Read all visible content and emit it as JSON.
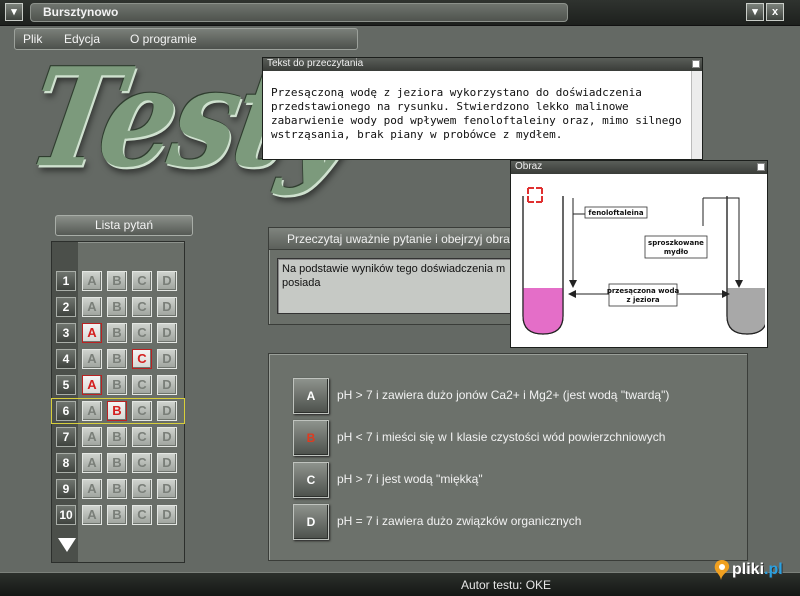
{
  "window": {
    "title": "Bursztynowo",
    "min_btn": "▾",
    "close_btn": "x",
    "menu_btn": "▾"
  },
  "menu": [
    "Plik",
    "Edycja",
    "O programie"
  ],
  "logo_text": "Testy",
  "question_list": {
    "header": "Lista pytań",
    "rows": [
      {
        "n": "1",
        "selected": ""
      },
      {
        "n": "2",
        "selected": ""
      },
      {
        "n": "3",
        "selected": "A"
      },
      {
        "n": "4",
        "selected": "C"
      },
      {
        "n": "5",
        "selected": "A"
      },
      {
        "n": "6",
        "selected": "B"
      },
      {
        "n": "7",
        "selected": ""
      },
      {
        "n": "8",
        "selected": ""
      },
      {
        "n": "9",
        "selected": ""
      },
      {
        "n": "10",
        "selected": ""
      }
    ],
    "options": [
      "A",
      "B",
      "C",
      "D"
    ],
    "current_row": "6"
  },
  "reading": {
    "title": "Tekst do przeczytania",
    "lines": [
      "Przesączoną wodę z jeziora wykorzystano do doświadczenia",
      "przedstawionego na rysunku. Stwierdzono lekko malinowe",
      "zabarwienie wody pod wpływem fenoloftaleiny oraz, mimo silnego",
      "wstrząsania, brak piany w probówce z mydłem."
    ]
  },
  "question": {
    "title": "Przeczytaj uważnie pytanie i obejrzyj obraz",
    "text": "Na podstawie wyników tego doświadczenia m\nposiada"
  },
  "image": {
    "title": "Obraz",
    "labels": {
      "indicator": "fenoloftaleina",
      "soap": "sproszkowane\nmydło",
      "water": "przesączona woda\nz jeziora"
    }
  },
  "answers": [
    {
      "letter": "A",
      "text": "pH > 7 i zawiera dużo jonów Ca2+ i Mg2+ (jest wodą \"twardą\")",
      "selected": false
    },
    {
      "letter": "B",
      "text": "pH < 7 i mieści się w I klasie czystości wód powierzchniowych",
      "selected": true
    },
    {
      "letter": "C",
      "text": "pH > 7 i jest wodą \"miękką\"",
      "selected": false
    },
    {
      "letter": "D",
      "text": "pH = 7 i zawiera dużo związków organicznych",
      "selected": false
    }
  ],
  "status": {
    "text": "Autor testu:  OKE"
  },
  "watermark": {
    "text_main": "pliki",
    "text_tld": ".pl"
  },
  "colors": {
    "selected_answer": "#d42020",
    "highlight_row": "#d8cf3a",
    "liquid_pink": "#e46ec8",
    "liquid_gray": "#a8a8a8"
  }
}
